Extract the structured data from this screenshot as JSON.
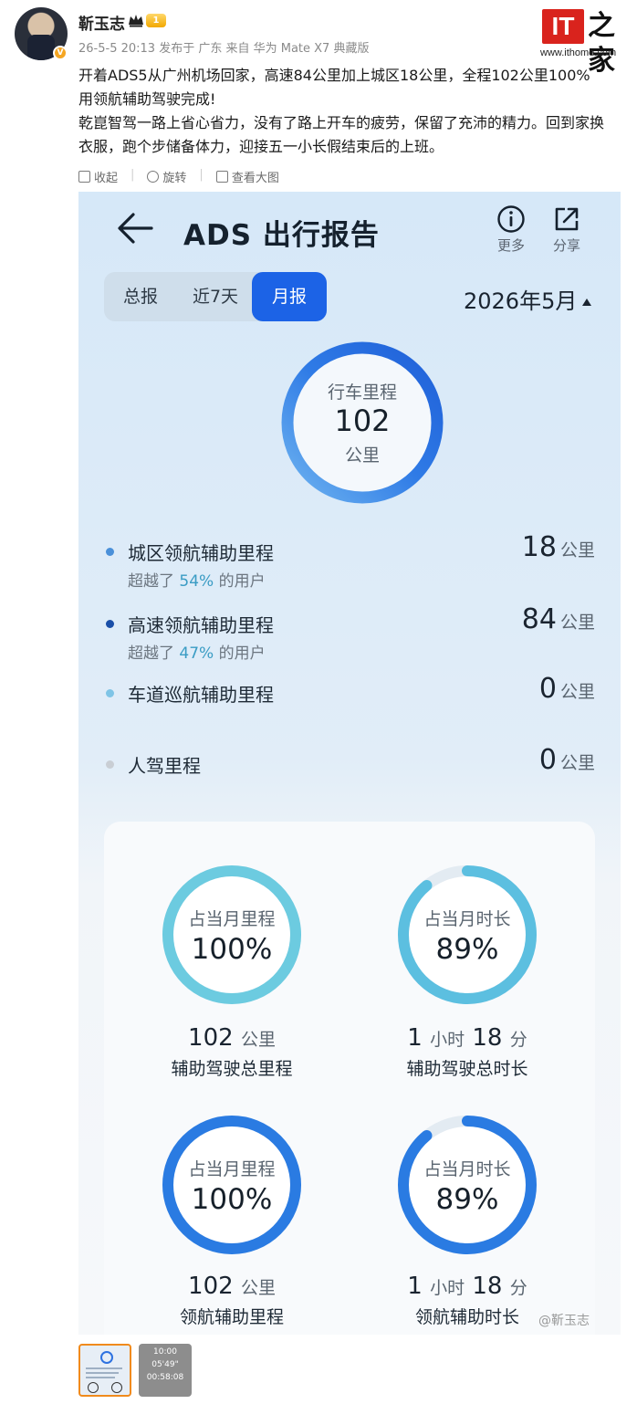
{
  "post": {
    "username": "靳玉志",
    "level_badge": "1",
    "meta": "26-5-5 20:13  发布于 广东  来自 华为 Mate X7 典藏版",
    "text_lines": [
      "开着ADS5从广州机场回家，高速84公里加上城区18公里，全程102公里100%",
      "用领航辅助驾驶完成!",
      "乾崑智驾一路上省心省力，没有了路上开车的疲劳，保留了充沛的精力。回到家换",
      "衣服，跑个步储备体力，迎接五一小长假结束后的上班。"
    ],
    "image_actions": [
      "收起",
      "旋转",
      "查看大图"
    ],
    "watermark": "@靳玉志"
  },
  "branding": {
    "it": "IT",
    "zh": "之家",
    "url": "www.ithome.com"
  },
  "report": {
    "title": "ADS 出行报告",
    "more_label": "更多",
    "share_label": "分享",
    "tabs": [
      "总报",
      "近7天",
      "月报"
    ],
    "active_tab": 2,
    "month": "2026年5月",
    "main_ring": {
      "label": "行车里程",
      "value": "102",
      "unit": "公里",
      "fill": 1.0
    },
    "stats": [
      {
        "label": "城区领航辅助里程",
        "sub_prefix": "超越了 ",
        "sub_pct": "54%",
        "sub_suffix": " 的用户",
        "value": "18",
        "unit": "公里",
        "dot_color": "#4a90d9"
      },
      {
        "label": "高速领航辅助里程",
        "sub_prefix": "超越了 ",
        "sub_pct": "47%",
        "sub_suffix": " 的用户",
        "value": "84",
        "unit": "公里",
        "dot_color": "#1a4fa8"
      },
      {
        "label": "车道巡航辅助里程",
        "value": "0",
        "unit": "公里",
        "dot_color": "#7fc4e6"
      },
      {
        "label": "人驾里程",
        "value": "0",
        "unit": "公里",
        "dot_color": "#c9ced4"
      }
    ],
    "rings": [
      {
        "label": "占当月里程",
        "value": "100%",
        "fill": 1.0,
        "color": "#6ccbe0",
        "track": "#e3ebf2",
        "metric_num": "102",
        "metric_unit": "公里",
        "metric_label": "辅助驾驶总里程"
      },
      {
        "label": "占当月时长",
        "value": "89%",
        "fill": 0.89,
        "color": "#5cbfe0",
        "track": "#e3ebf2",
        "metric_num1": "1",
        "metric_unit1": "小时",
        "metric_num2": "18",
        "metric_unit2": "分",
        "metric_label": "辅助驾驶总时长"
      },
      {
        "label": "占当月里程",
        "value": "100%",
        "fill": 1.0,
        "color": "#2a7be2",
        "track": "#e3ebf2",
        "metric_num": "102",
        "metric_unit": "公里",
        "metric_label": "领航辅助里程"
      },
      {
        "label": "占当月时长",
        "value": "89%",
        "fill": 0.89,
        "color": "#2a7be2",
        "track": "#e3ebf2",
        "metric_num1": "1",
        "metric_unit1": "小时",
        "metric_num2": "18",
        "metric_unit2": "分",
        "metric_label": "领航辅助时长"
      }
    ]
  },
  "thumbnails": {
    "second_lines": [
      "10:00",
      "05'49\"",
      "00:58:08"
    ]
  }
}
